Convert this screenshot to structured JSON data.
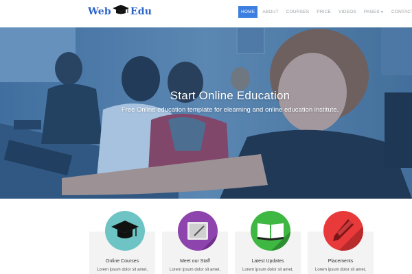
{
  "header": {
    "logo": {
      "word1": "Web",
      "word2": "Edu",
      "color": "#2b63c9"
    },
    "nav": [
      {
        "label": "HOME",
        "active": true
      },
      {
        "label": "ABOUT"
      },
      {
        "label": "COURSES"
      },
      {
        "label": "PRICE"
      },
      {
        "label": "VIDEOS"
      },
      {
        "label": "PAGES"
      },
      {
        "label": "CONTACT"
      }
    ],
    "accent": "#3d7fe0"
  },
  "hero": {
    "title": "Start Online Education",
    "subtitle": "Free Online education template for elearning and online education institute."
  },
  "features": [
    {
      "icon": "graduation-cap-icon",
      "color": "#6ec4c4",
      "title": "Online Courses",
      "text": "Lorem ipsum dolor sit amet,"
    },
    {
      "icon": "tablet-pen-icon",
      "color": "#8e44ad",
      "title": "Meet our Staff",
      "text": "Lorem ipsum dolor sit amet,"
    },
    {
      "icon": "open-book-icon",
      "color": "#3fb743",
      "title": "Latest Updates",
      "text": "Lorem ipsum dolor sit amet,"
    },
    {
      "icon": "pen-icon",
      "color": "#e8393b",
      "title": "Placements",
      "text": "Lorem ipsum dolor sit amet,"
    }
  ]
}
